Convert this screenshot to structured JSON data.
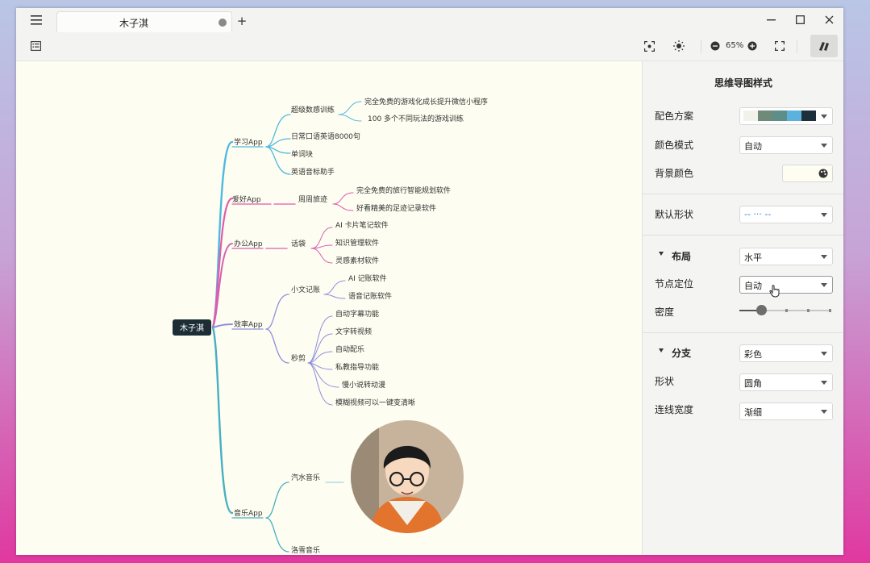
{
  "tab": {
    "title": "木子淇"
  },
  "toolbar": {
    "zoom": "65%"
  },
  "panel": {
    "title": "思维导图样式",
    "color_scheme_label": "配色方案",
    "color_scheme_swatches": [
      "#f2f2ec",
      "#6f8a78",
      "#5d8e88",
      "#5ab2dd",
      "#1e2f3c"
    ],
    "color_mode_label": "颜色模式",
    "color_mode_value": "自动",
    "bg_color_label": "背景颜色",
    "bg_color_value": "#fdfdf1",
    "default_shape_label": "默认形状",
    "default_shape_value": "-- ··· --",
    "layout_section": "布局",
    "layout_value": "水平",
    "node_position_label": "节点定位",
    "node_position_value": "自动",
    "density_label": "密度",
    "density_level": 0.24,
    "branch_section": "分支",
    "branch_color_value": "彩色",
    "shape_label": "形状",
    "shape_value": "圆角",
    "line_width_label": "连线宽度",
    "line_width_value": "渐细"
  },
  "mindmap": {
    "root": "木子淇",
    "branches": {
      "b1": "学习App",
      "b1_1": "超级数感训练",
      "b1_1_1": "完全免费的游戏化成长提升微信小程序",
      "b1_1_2": "100 多个不同玩法的游戏训练",
      "b1_2": "日常口语英语8000句",
      "b1_3": "单词块",
      "b1_4": "英语音标助手",
      "b2": "爱好App",
      "b2_1": "周周旅迹",
      "b2_1_1": "完全免费的旅行智能规划软件",
      "b2_1_2": "好看精美的足迹记录软件",
      "b3": "办公App",
      "b3_1": "话袋",
      "b3_1_1": "AI 卡片笔记软件",
      "b3_1_2": "知识管理软件",
      "b3_1_3": "灵感素材软件",
      "b4": "效率App",
      "b4_1": "小文记账",
      "b4_1_1": "AI 记账软件",
      "b4_1_2": "语音记账软件",
      "b4_2": "秒剪",
      "b4_2_1": "自动字幕功能",
      "b4_2_2": "文字转视频",
      "b4_2_3": "自动配乐",
      "b4_2_4": "私教指导功能",
      "b4_2_5": "慢小说转动漫",
      "b4_2_6": "模糊视频可以一键变清晰",
      "b5": "音乐App",
      "b5_1": "汽水音乐",
      "b5_2": "洛雪音乐"
    }
  }
}
